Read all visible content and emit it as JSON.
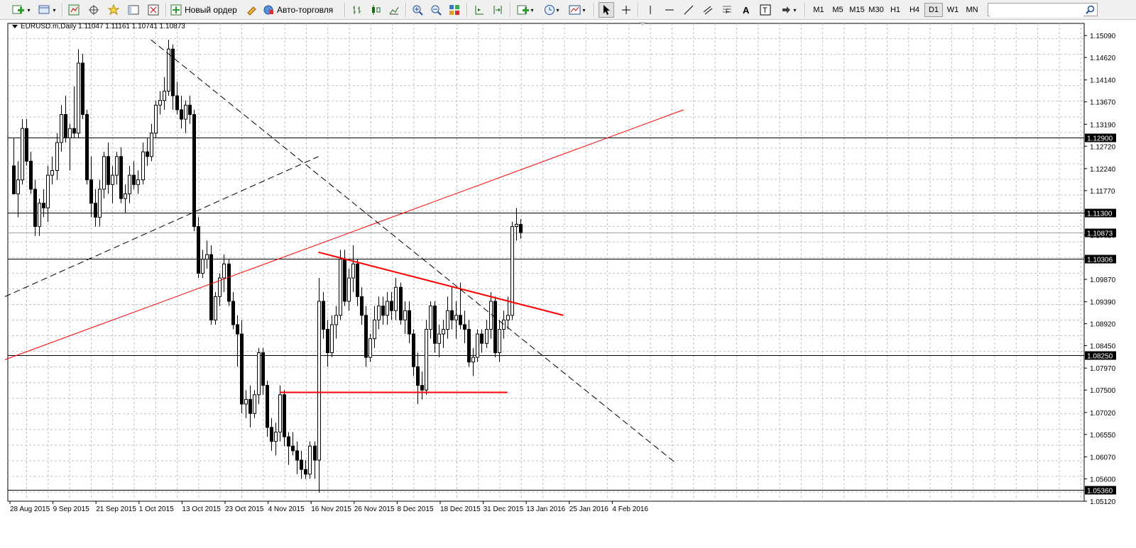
{
  "toolbar": {
    "new_order_label": "Новый ордер",
    "auto_trading_label": "Авто-торговля",
    "timeframes": [
      "M1",
      "M5",
      "M15",
      "M30",
      "H1",
      "H4",
      "D1",
      "W1",
      "MN"
    ],
    "active_timeframe": "D1",
    "search_placeholder": ""
  },
  "chart": {
    "symbol_label": "EURUSD.m,Daily  1.11047 1.11161 1.10741 1.10873",
    "price_ticks": [
      "1.15090",
      "1.14620",
      "1.14140",
      "1.13670",
      "1.13190",
      "1.12720",
      "1.12240",
      "1.11770",
      "1.11290",
      "1.10820",
      "1.10340",
      "1.09870",
      "1.09390",
      "1.08920",
      "1.08450",
      "1.07970",
      "1.07500",
      "1.07020",
      "1.06550",
      "1.06070",
      "1.05600",
      "1.05120"
    ],
    "date_ticks": [
      "28 Aug 2015",
      "9 Sep 2015",
      "21 Sep 2015",
      "1 Oct 2015",
      "13 Oct 2015",
      "23 Oct 2015",
      "4 Nov 2015",
      "16 Nov 2015",
      "26 Nov 2015",
      "8 Dec 2015",
      "18 Dec 2015",
      "31 Dec 2015",
      "13 Jan 2016",
      "25 Jan 2016",
      "4 Feb 2016"
    ],
    "hlines": [
      {
        "price": 1.129,
        "label": "1.12900"
      },
      {
        "price": 1.113,
        "label": "1.11300"
      },
      {
        "price": 1.10306,
        "label": "1.10306"
      },
      {
        "price": 1.0825,
        "label": "1.08250"
      },
      {
        "price": 1.0536,
        "label": "1.05360"
      }
    ],
    "current_price": {
      "price": 1.10873,
      "label": "1.10873"
    },
    "colors": {
      "bull": "#ffffff",
      "bear": "#000000",
      "trend": "#ff0000",
      "grid": "#c0c0c0",
      "level": "#000000"
    }
  },
  "chart_data": {
    "type": "candlestick",
    "symbol": "EURUSD.m",
    "timeframe": "Daily",
    "ylim": [
      1.0512,
      1.1535
    ],
    "grid": true,
    "candles": [
      {
        "o": 1.123,
        "h": 1.129,
        "l": 1.118,
        "c": 1.117
      },
      {
        "o": 1.117,
        "h": 1.124,
        "l": 1.112,
        "c": 1.12
      },
      {
        "o": 1.12,
        "h": 1.133,
        "l": 1.119,
        "c": 1.131
      },
      {
        "o": 1.131,
        "h": 1.133,
        "l": 1.123,
        "c": 1.124
      },
      {
        "o": 1.124,
        "h": 1.126,
        "l": 1.117,
        "c": 1.118
      },
      {
        "o": 1.118,
        "h": 1.12,
        "l": 1.108,
        "c": 1.11
      },
      {
        "o": 1.11,
        "h": 1.116,
        "l": 1.108,
        "c": 1.115
      },
      {
        "o": 1.115,
        "h": 1.118,
        "l": 1.112,
        "c": 1.114
      },
      {
        "o": 1.114,
        "h": 1.123,
        "l": 1.111,
        "c": 1.121
      },
      {
        "o": 1.121,
        "h": 1.125,
        "l": 1.119,
        "c": 1.122
      },
      {
        "o": 1.122,
        "h": 1.13,
        "l": 1.12,
        "c": 1.128
      },
      {
        "o": 1.128,
        "h": 1.136,
        "l": 1.126,
        "c": 1.134
      },
      {
        "o": 1.134,
        "h": 1.138,
        "l": 1.128,
        "c": 1.129
      },
      {
        "o": 1.129,
        "h": 1.132,
        "l": 1.122,
        "c": 1.131
      },
      {
        "o": 1.131,
        "h": 1.14,
        "l": 1.129,
        "c": 1.13
      },
      {
        "o": 1.13,
        "h": 1.148,
        "l": 1.129,
        "c": 1.145
      },
      {
        "o": 1.145,
        "h": 1.147,
        "l": 1.133,
        "c": 1.134
      },
      {
        "o": 1.134,
        "h": 1.135,
        "l": 1.119,
        "c": 1.12
      },
      {
        "o": 1.12,
        "h": 1.125,
        "l": 1.112,
        "c": 1.115
      },
      {
        "o": 1.115,
        "h": 1.118,
        "l": 1.11,
        "c": 1.112
      },
      {
        "o": 1.112,
        "h": 1.12,
        "l": 1.11,
        "c": 1.118
      },
      {
        "o": 1.118,
        "h": 1.126,
        "l": 1.116,
        "c": 1.125
      },
      {
        "o": 1.125,
        "h": 1.128,
        "l": 1.117,
        "c": 1.119
      },
      {
        "o": 1.119,
        "h": 1.123,
        "l": 1.115,
        "c": 1.121
      },
      {
        "o": 1.121,
        "h": 1.126,
        "l": 1.119,
        "c": 1.125
      },
      {
        "o": 1.125,
        "h": 1.127,
        "l": 1.115,
        "c": 1.116
      },
      {
        "o": 1.116,
        "h": 1.119,
        "l": 1.113,
        "c": 1.117
      },
      {
        "o": 1.117,
        "h": 1.123,
        "l": 1.115,
        "c": 1.121
      },
      {
        "o": 1.121,
        "h": 1.124,
        "l": 1.118,
        "c": 1.119
      },
      {
        "o": 1.119,
        "h": 1.122,
        "l": 1.117,
        "c": 1.12
      },
      {
        "o": 1.12,
        "h": 1.128,
        "l": 1.119,
        "c": 1.126
      },
      {
        "o": 1.126,
        "h": 1.129,
        "l": 1.123,
        "c": 1.125
      },
      {
        "o": 1.125,
        "h": 1.132,
        "l": 1.124,
        "c": 1.13
      },
      {
        "o": 1.13,
        "h": 1.137,
        "l": 1.129,
        "c": 1.136
      },
      {
        "o": 1.136,
        "h": 1.139,
        "l": 1.134,
        "c": 1.137
      },
      {
        "o": 1.137,
        "h": 1.142,
        "l": 1.135,
        "c": 1.139
      },
      {
        "o": 1.139,
        "h": 1.15,
        "l": 1.138,
        "c": 1.148
      },
      {
        "o": 1.148,
        "h": 1.149,
        "l": 1.135,
        "c": 1.138
      },
      {
        "o": 1.138,
        "h": 1.141,
        "l": 1.134,
        "c": 1.135
      },
      {
        "o": 1.135,
        "h": 1.138,
        "l": 1.131,
        "c": 1.133
      },
      {
        "o": 1.133,
        "h": 1.137,
        "l": 1.13,
        "c": 1.136
      },
      {
        "o": 1.136,
        "h": 1.138,
        "l": 1.132,
        "c": 1.134
      },
      {
        "o": 1.134,
        "h": 1.135,
        "l": 1.109,
        "c": 1.11
      },
      {
        "o": 1.11,
        "h": 1.112,
        "l": 1.099,
        "c": 1.1
      },
      {
        "o": 1.1,
        "h": 1.105,
        "l": 1.099,
        "c": 1.103
      },
      {
        "o": 1.103,
        "h": 1.107,
        "l": 1.101,
        "c": 1.104
      },
      {
        "o": 1.104,
        "h": 1.106,
        "l": 1.089,
        "c": 1.09
      },
      {
        "o": 1.09,
        "h": 1.096,
        "l": 1.089,
        "c": 1.095
      },
      {
        "o": 1.095,
        "h": 1.1,
        "l": 1.093,
        "c": 1.099
      },
      {
        "o": 1.099,
        "h": 1.104,
        "l": 1.096,
        "c": 1.102
      },
      {
        "o": 1.102,
        "h": 1.103,
        "l": 1.093,
        "c": 1.094
      },
      {
        "o": 1.094,
        "h": 1.096,
        "l": 1.088,
        "c": 1.089
      },
      {
        "o": 1.089,
        "h": 1.091,
        "l": 1.08,
        "c": 1.087
      },
      {
        "o": 1.087,
        "h": 1.09,
        "l": 1.07,
        "c": 1.072
      },
      {
        "o": 1.072,
        "h": 1.075,
        "l": 1.069,
        "c": 1.073
      },
      {
        "o": 1.073,
        "h": 1.076,
        "l": 1.067,
        "c": 1.07
      },
      {
        "o": 1.07,
        "h": 1.075,
        "l": 1.069,
        "c": 1.074
      },
      {
        "o": 1.074,
        "h": 1.084,
        "l": 1.072,
        "c": 1.083
      },
      {
        "o": 1.083,
        "h": 1.084,
        "l": 1.074,
        "c": 1.076
      },
      {
        "o": 1.076,
        "h": 1.077,
        "l": 1.065,
        "c": 1.067
      },
      {
        "o": 1.067,
        "h": 1.069,
        "l": 1.062,
        "c": 1.064
      },
      {
        "o": 1.064,
        "h": 1.068,
        "l": 1.061,
        "c": 1.066
      },
      {
        "o": 1.066,
        "h": 1.076,
        "l": 1.064,
        "c": 1.074
      },
      {
        "o": 1.074,
        "h": 1.075,
        "l": 1.063,
        "c": 1.065
      },
      {
        "o": 1.065,
        "h": 1.066,
        "l": 1.059,
        "c": 1.063
      },
      {
        "o": 1.063,
        "h": 1.066,
        "l": 1.061,
        "c": 1.062
      },
      {
        "o": 1.062,
        "h": 1.064,
        "l": 1.057,
        "c": 1.06
      },
      {
        "o": 1.06,
        "h": 1.062,
        "l": 1.056,
        "c": 1.058
      },
      {
        "o": 1.058,
        "h": 1.06,
        "l": 1.056,
        "c": 1.057
      },
      {
        "o": 1.057,
        "h": 1.064,
        "l": 1.056,
        "c": 1.063
      },
      {
        "o": 1.063,
        "h": 1.064,
        "l": 1.056,
        "c": 1.06
      },
      {
        "o": 1.06,
        "h": 1.099,
        "l": 1.053,
        "c": 1.094
      },
      {
        "o": 1.094,
        "h": 1.096,
        "l": 1.086,
        "c": 1.088
      },
      {
        "o": 1.088,
        "h": 1.09,
        "l": 1.08,
        "c": 1.083
      },
      {
        "o": 1.083,
        "h": 1.091,
        "l": 1.082,
        "c": 1.089
      },
      {
        "o": 1.089,
        "h": 1.093,
        "l": 1.086,
        "c": 1.091
      },
      {
        "o": 1.091,
        "h": 1.105,
        "l": 1.09,
        "c": 1.103
      },
      {
        "o": 1.103,
        "h": 1.105,
        "l": 1.093,
        "c": 1.094
      },
      {
        "o": 1.094,
        "h": 1.101,
        "l": 1.092,
        "c": 1.099
      },
      {
        "o": 1.099,
        "h": 1.106,
        "l": 1.096,
        "c": 1.102
      },
      {
        "o": 1.102,
        "h": 1.103,
        "l": 1.093,
        "c": 1.095
      },
      {
        "o": 1.095,
        "h": 1.097,
        "l": 1.089,
        "c": 1.091
      },
      {
        "o": 1.091,
        "h": 1.093,
        "l": 1.08,
        "c": 1.082
      },
      {
        "o": 1.082,
        "h": 1.087,
        "l": 1.081,
        "c": 1.086
      },
      {
        "o": 1.086,
        "h": 1.093,
        "l": 1.084,
        "c": 1.09
      },
      {
        "o": 1.09,
        "h": 1.095,
        "l": 1.088,
        "c": 1.093
      },
      {
        "o": 1.093,
        "h": 1.095,
        "l": 1.089,
        "c": 1.091
      },
      {
        "o": 1.091,
        "h": 1.096,
        "l": 1.089,
        "c": 1.094
      },
      {
        "o": 1.094,
        "h": 1.096,
        "l": 1.09,
        "c": 1.092
      },
      {
        "o": 1.092,
        "h": 1.099,
        "l": 1.09,
        "c": 1.097
      },
      {
        "o": 1.097,
        "h": 1.098,
        "l": 1.089,
        "c": 1.09
      },
      {
        "o": 1.09,
        "h": 1.094,
        "l": 1.087,
        "c": 1.092
      },
      {
        "o": 1.092,
        "h": 1.094,
        "l": 1.085,
        "c": 1.087
      },
      {
        "o": 1.087,
        "h": 1.088,
        "l": 1.078,
        "c": 1.08
      },
      {
        "o": 1.08,
        "h": 1.083,
        "l": 1.072,
        "c": 1.076
      },
      {
        "o": 1.076,
        "h": 1.079,
        "l": 1.073,
        "c": 1.075
      },
      {
        "o": 1.075,
        "h": 1.09,
        "l": 1.074,
        "c": 1.088
      },
      {
        "o": 1.088,
        "h": 1.094,
        "l": 1.086,
        "c": 1.093
      },
      {
        "o": 1.093,
        "h": 1.094,
        "l": 1.083,
        "c": 1.085
      },
      {
        "o": 1.085,
        "h": 1.089,
        "l": 1.082,
        "c": 1.087
      },
      {
        "o": 1.087,
        "h": 1.09,
        "l": 1.084,
        "c": 1.088
      },
      {
        "o": 1.088,
        "h": 1.095,
        "l": 1.086,
        "c": 1.092
      },
      {
        "o": 1.092,
        "h": 1.097,
        "l": 1.088,
        "c": 1.09
      },
      {
        "o": 1.09,
        "h": 1.094,
        "l": 1.086,
        "c": 1.091
      },
      {
        "o": 1.091,
        "h": 1.098,
        "l": 1.088,
        "c": 1.089
      },
      {
        "o": 1.089,
        "h": 1.092,
        "l": 1.085,
        "c": 1.088
      },
      {
        "o": 1.088,
        "h": 1.09,
        "l": 1.08,
        "c": 1.081
      },
      {
        "o": 1.081,
        "h": 1.084,
        "l": 1.078,
        "c": 1.082
      },
      {
        "o": 1.082,
        "h": 1.088,
        "l": 1.081,
        "c": 1.087
      },
      {
        "o": 1.087,
        "h": 1.088,
        "l": 1.083,
        "c": 1.085
      },
      {
        "o": 1.085,
        "h": 1.09,
        "l": 1.084,
        "c": 1.088
      },
      {
        "o": 1.088,
        "h": 1.096,
        "l": 1.086,
        "c": 1.094
      },
      {
        "o": 1.094,
        "h": 1.095,
        "l": 1.082,
        "c": 1.083
      },
      {
        "o": 1.083,
        "h": 1.09,
        "l": 1.081,
        "c": 1.088
      },
      {
        "o": 1.088,
        "h": 1.092,
        "l": 1.086,
        "c": 1.09
      },
      {
        "o": 1.09,
        "h": 1.095,
        "l": 1.088,
        "c": 1.091
      },
      {
        "o": 1.091,
        "h": 1.111,
        "l": 1.09,
        "c": 1.11
      },
      {
        "o": 1.11,
        "h": 1.114,
        "l": 1.107,
        "c": 1.1105
      },
      {
        "o": 1.11047,
        "h": 1.11161,
        "l": 1.10741,
        "c": 1.10873
      }
    ],
    "trendlines": [
      {
        "style": "red",
        "width": 1,
        "a": {
          "i": -2,
          "p": 1.0815
        },
        "b": {
          "i": 156,
          "p": 1.135
        }
      },
      {
        "style": "red",
        "width": 2,
        "a": {
          "i": 71,
          "p": 1.1045
        },
        "b": {
          "i": 128,
          "p": 1.091
        }
      },
      {
        "style": "red",
        "width": 2,
        "a": {
          "i": 62,
          "p": 1.0745
        },
        "b": {
          "i": 115,
          "p": 1.0745
        }
      },
      {
        "style": "dashed",
        "width": 1,
        "a": {
          "i": -2,
          "p": 1.095
        },
        "b": {
          "i": 71,
          "p": 1.125
        }
      },
      {
        "style": "dashed",
        "width": 1,
        "a": {
          "i": 32,
          "p": 1.15
        },
        "b": {
          "i": 154,
          "p": 1.0595
        }
      }
    ]
  }
}
